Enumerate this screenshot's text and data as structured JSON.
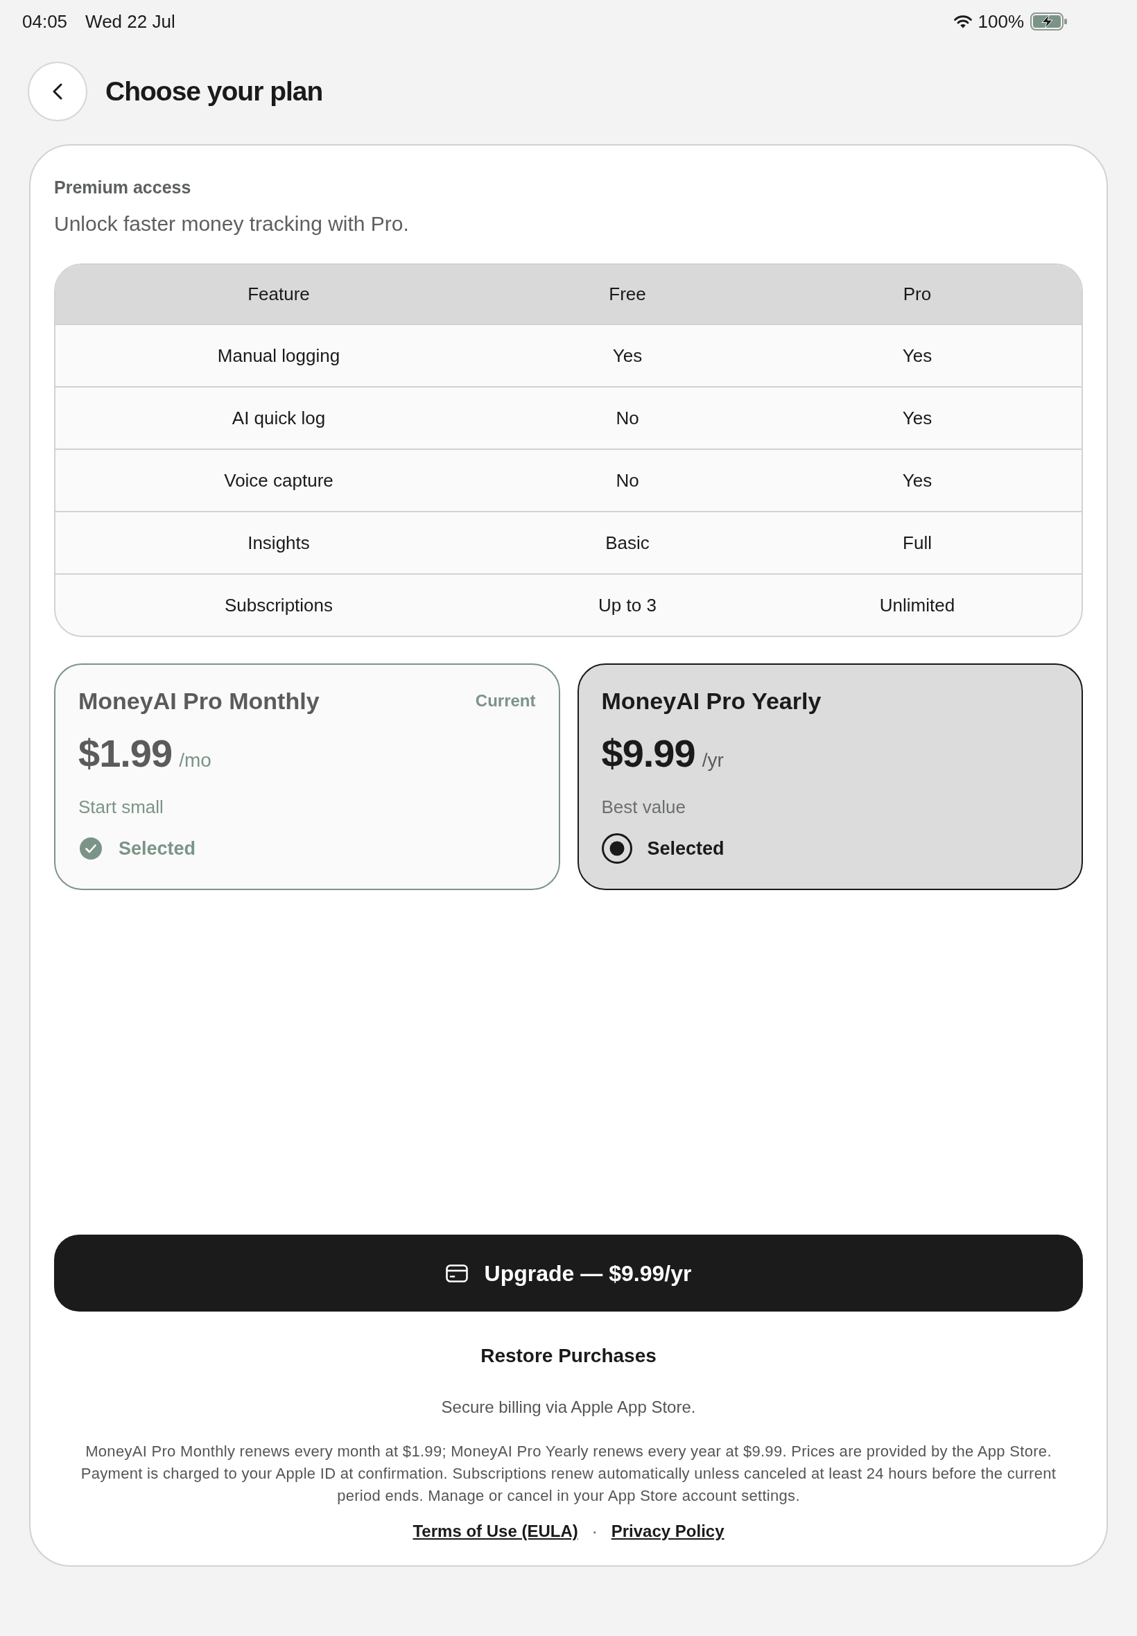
{
  "status_bar": {
    "time": "04:05",
    "date": "Wed 22 Jul",
    "battery": "100%"
  },
  "header": {
    "title": "Choose your plan"
  },
  "intro": {
    "eyebrow": "Premium access",
    "headline": "Unlock faster money tracking with Pro."
  },
  "comparison_table": {
    "columns": [
      "Feature",
      "Free",
      "Pro"
    ],
    "rows": [
      [
        "Manual logging",
        "Yes",
        "Yes"
      ],
      [
        "AI quick log",
        "No",
        "Yes"
      ],
      [
        "Voice capture",
        "No",
        "Yes"
      ],
      [
        "Insights",
        "Basic",
        "Full"
      ],
      [
        "Subscriptions",
        "Up to 3",
        "Unlimited"
      ]
    ]
  },
  "plans": [
    {
      "name": "MoneyAI Pro Monthly",
      "badge": "Current",
      "current": true,
      "price": "$1.99",
      "period": "/mo",
      "tagline": "Start small",
      "status": "Selected",
      "selected": false
    },
    {
      "name": "MoneyAI Pro Yearly",
      "current": false,
      "price": "$9.99",
      "period": "/yr",
      "tagline": "Best value",
      "status": "Selected",
      "selected": true
    }
  ],
  "upgrade_button": {
    "label": "Upgrade — $9.99/yr"
  },
  "restore_button": {
    "label": "Restore Purchases"
  },
  "billing_note": "Secure billing via Apple App Store.",
  "legal_text": "MoneyAI Pro Monthly renews every month at $1.99; MoneyAI Pro Yearly renews every year at $9.99. Prices are provided by the App Store. Payment is charged to your Apple ID at confirmation. Subscriptions renew automatically unless canceled at least 24 hours before the current period ends. Manage or cancel in your App Store account settings.",
  "links": [
    {
      "label": "Terms of Use (EULA)"
    },
    {
      "label": "Privacy Policy"
    }
  ],
  "link_separator": "·"
}
